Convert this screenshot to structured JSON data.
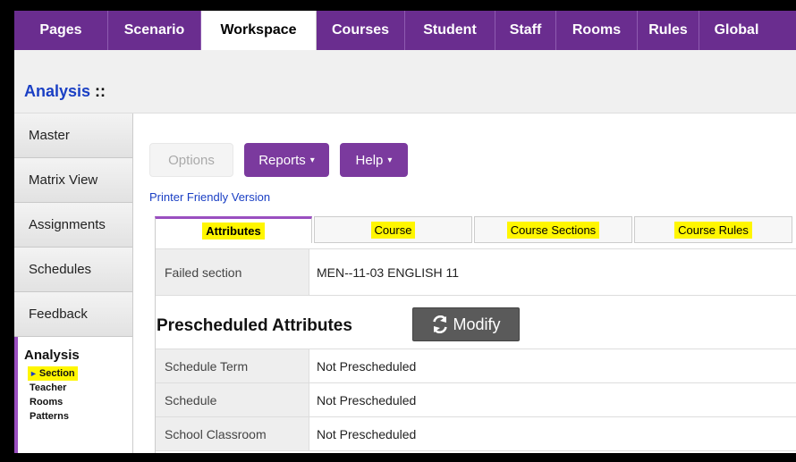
{
  "topnav": {
    "tabs": [
      {
        "label": "Pages",
        "width": 105
      },
      {
        "label": "Scenario",
        "width": 104
      },
      {
        "label": "Workspace",
        "width": 129,
        "active": true
      },
      {
        "label": "Courses",
        "width": 99
      },
      {
        "label": "Student",
        "width": 101
      },
      {
        "label": "Staff",
        "width": 68
      },
      {
        "label": "Rooms",
        "width": 91
      },
      {
        "label": "Rules",
        "width": 69
      },
      {
        "label": "Global",
        "width": 83
      }
    ]
  },
  "header": {
    "title": "Analysis",
    "separator": " ::"
  },
  "sidebar": {
    "items": [
      {
        "label": "Master"
      },
      {
        "label": "Matrix View"
      },
      {
        "label": "Assignments"
      },
      {
        "label": "Schedules"
      },
      {
        "label": "Feedback"
      }
    ],
    "active_group": {
      "heading": "Analysis",
      "items": [
        {
          "label": "Section",
          "selected": true,
          "marker": "►"
        },
        {
          "label": "Teacher"
        },
        {
          "label": "Rooms"
        },
        {
          "label": "Patterns"
        }
      ]
    }
  },
  "toolbar": {
    "options_label": "Options",
    "reports_label": "Reports",
    "help_label": "Help",
    "caret": "▾"
  },
  "printer_link": "Printer Friendly Version",
  "subtabs": [
    {
      "label": "Attributes",
      "active": true
    },
    {
      "label": "Course"
    },
    {
      "label": "Course Sections"
    },
    {
      "label": "Course Rules"
    }
  ],
  "failed": {
    "key": "Failed section",
    "value": "MEN--11-03 ENGLISH 11"
  },
  "prescheduled": {
    "title": "Prescheduled Attributes",
    "modify_label": "Modify",
    "rows": [
      {
        "key": "Schedule Term",
        "value": "Not Prescheduled"
      },
      {
        "key": "Schedule",
        "value": "Not Prescheduled"
      },
      {
        "key": "School Classroom",
        "value": "Not Prescheduled"
      }
    ]
  },
  "colors": {
    "nav_purple": "#6a2d8f",
    "button_purple": "#7b3a9e",
    "link_blue": "#1a3fc4",
    "highlight": "#fff600"
  }
}
